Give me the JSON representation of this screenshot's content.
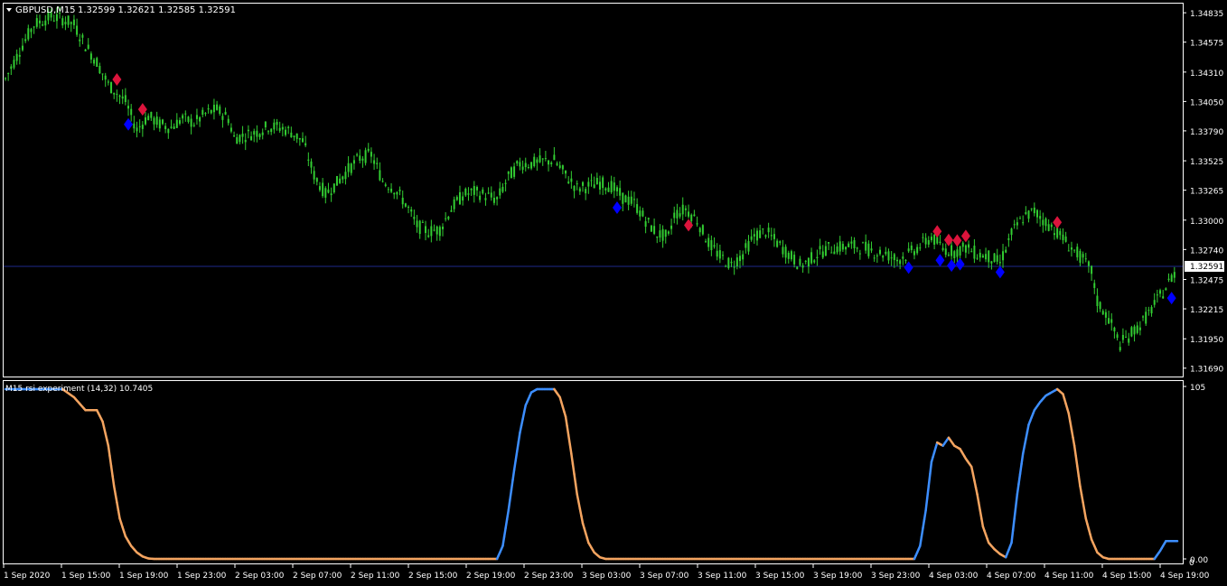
{
  "main_header": {
    "menu_icon": "triangle-down-icon",
    "symbol": "GBPUSD,M15",
    "ohlc": "1.32599 1.32621 1.32585 1.32591"
  },
  "sub_header": {
    "label": "M15 rsi experiment (14,32) 10.7405"
  },
  "price_axis": {
    "ticks": [
      "1.34835",
      "1.34575",
      "1.34310",
      "1.34050",
      "1.33790",
      "1.33525",
      "1.33265",
      "1.33000",
      "1.32740",
      "1.32475",
      "1.32215",
      "1.31950",
      "1.31690"
    ],
    "current_price": "1.32591"
  },
  "osc_axis": {
    "ticks": [
      "105",
      "0.00"
    ],
    "extra": "0"
  },
  "time_axis": {
    "labels": [
      "1 Sep 2020",
      "1 Sep 15:00",
      "1 Sep 19:00",
      "1 Sep 23:00",
      "2 Sep 03:00",
      "2 Sep 07:00",
      "2 Sep 11:00",
      "2 Sep 15:00",
      "2 Sep 19:00",
      "2 Sep 23:00",
      "3 Sep 03:00",
      "3 Sep 07:00",
      "3 Sep 11:00",
      "3 Sep 15:00",
      "3 Sep 19:00",
      "3 Sep 23:00",
      "4 Sep 03:00",
      "4 Sep 07:00",
      "4 Sep 11:00",
      "4 Sep 15:00",
      "4 Sep 19:00"
    ]
  },
  "colors": {
    "background": "#000000",
    "grid": "#ffffff",
    "candles": "#32cd32",
    "price_line": "#1e2a8c",
    "sell_marker": "#dc143c",
    "buy_marker": "#0000ff",
    "rsi_up": "#3d8eff",
    "rsi_down": "#f4a460"
  },
  "chart_data": [
    {
      "type": "candlestick",
      "title": "GBPUSD,M15",
      "ylim": [
        1.3164,
        1.349
      ],
      "price_line": 1.32591,
      "path": [
        [
          0,
          1.3425
        ],
        [
          3,
          1.3455
        ],
        [
          5,
          1.3473
        ],
        [
          8,
          1.348
        ],
        [
          10,
          1.3478
        ],
        [
          12,
          1.3473
        ],
        [
          14,
          1.3455
        ],
        [
          16,
          1.344
        ],
        [
          18,
          1.342
        ],
        [
          21,
          1.3405
        ],
        [
          23,
          1.338
        ],
        [
          25,
          1.3392
        ],
        [
          27,
          1.3385
        ],
        [
          29,
          1.3382
        ],
        [
          31,
          1.339
        ],
        [
          33,
          1.3386
        ],
        [
          35,
          1.3394
        ],
        [
          37,
          1.3398
        ],
        [
          39,
          1.339
        ],
        [
          40,
          1.3373
        ],
        [
          42,
          1.3375
        ],
        [
          44,
          1.3378
        ],
        [
          46,
          1.3383
        ],
        [
          48,
          1.3382
        ],
        [
          50,
          1.3378
        ],
        [
          52,
          1.337
        ],
        [
          54,
          1.334
        ],
        [
          56,
          1.3323
        ],
        [
          58,
          1.3333
        ],
        [
          60,
          1.3345
        ],
        [
          62,
          1.3355
        ],
        [
          64,
          1.3358
        ],
        [
          66,
          1.3335
        ],
        [
          68,
          1.3328
        ],
        [
          70,
          1.3315
        ],
        [
          72,
          1.3295
        ],
        [
          74,
          1.329
        ],
        [
          76,
          1.3292
        ],
        [
          78,
          1.331
        ],
        [
          80,
          1.3322
        ],
        [
          82,
          1.3325
        ],
        [
          84,
          1.3322
        ],
        [
          86,
          1.3318
        ],
        [
          88,
          1.3338
        ],
        [
          90,
          1.335
        ],
        [
          92,
          1.335
        ],
        [
          94,
          1.3352
        ],
        [
          96,
          1.3353
        ],
        [
          98,
          1.334
        ],
        [
          100,
          1.3328
        ],
        [
          102,
          1.333
        ],
        [
          104,
          1.3333
        ],
        [
          106,
          1.333
        ],
        [
          108,
          1.332
        ],
        [
          110,
          1.3315
        ],
        [
          112,
          1.33
        ],
        [
          114,
          1.3288
        ],
        [
          116,
          1.3285
        ],
        [
          117,
          1.3305
        ],
        [
          119,
          1.331
        ],
        [
          121,
          1.33
        ],
        [
          123,
          1.328
        ],
        [
          125,
          1.3268
        ],
        [
          127,
          1.326
        ],
        [
          129,
          1.327
        ],
        [
          131,
          1.3286
        ],
        [
          133,
          1.329
        ],
        [
          135,
          1.328
        ],
        [
          137,
          1.327
        ],
        [
          139,
          1.326
        ],
        [
          140,
          1.3262
        ],
        [
          142,
          1.327
        ],
        [
          144,
          1.3275
        ],
        [
          146,
          1.3276
        ],
        [
          148,
          1.3277
        ],
        [
          150,
          1.3276
        ],
        [
          152,
          1.3272
        ],
        [
          154,
          1.327
        ],
        [
          156,
          1.3265
        ],
        [
          158,
          1.327
        ],
        [
          160,
          1.3277
        ],
        [
          162,
          1.3285
        ],
        [
          164,
          1.3275
        ],
        [
          166,
          1.3272
        ],
        [
          168,
          1.3276
        ],
        [
          170,
          1.327
        ],
        [
          172,
          1.3268
        ],
        [
          174,
          1.3262
        ],
        [
          176,
          1.3288
        ],
        [
          178,
          1.3302
        ],
        [
          180,
          1.3308
        ],
        [
          182,
          1.3298
        ],
        [
          184,
          1.329
        ],
        [
          186,
          1.3278
        ],
        [
          188,
          1.3268
        ],
        [
          190,
          1.3255
        ],
        [
          191,
          1.3228
        ],
        [
          193,
          1.3213
        ],
        [
          195,
          1.319
        ],
        [
          197,
          1.32
        ],
        [
          199,
          1.321
        ],
        [
          201,
          1.3225
        ],
        [
          203,
          1.324
        ],
        [
          205,
          1.3258
        ]
      ]
    },
    {
      "type": "line",
      "title": "M15 rsi experiment (14,32) 10.7405",
      "ylim": [
        0,
        105
      ],
      "series": [
        {
          "path": [
            [
              0,
              105
            ],
            [
              10,
              105
            ],
            [
              12,
              100
            ],
            [
              14,
              92
            ],
            [
              16,
              92
            ],
            [
              17,
              85
            ],
            [
              18,
              70
            ],
            [
              19,
              45
            ],
            [
              20,
              25
            ],
            [
              21,
              14
            ],
            [
              22,
              8
            ],
            [
              23,
              4
            ],
            [
              24,
              1.5
            ],
            [
              25,
              0.3
            ],
            [
              26,
              0
            ],
            [
              86,
              0
            ],
            [
              87,
              8
            ],
            [
              88,
              30
            ],
            [
              89,
              55
            ],
            [
              90,
              78
            ],
            [
              91,
              95
            ],
            [
              92,
              103
            ],
            [
              93,
              105
            ],
            [
              96,
              105
            ],
            [
              97,
              100
            ],
            [
              98,
              88
            ],
            [
              99,
              65
            ],
            [
              100,
              40
            ],
            [
              101,
              22
            ],
            [
              102,
              10
            ],
            [
              103,
              4
            ],
            [
              104,
              1
            ],
            [
              105,
              0
            ],
            [
              159,
              0
            ],
            [
              160,
              8
            ],
            [
              161,
              30
            ],
            [
              162,
              60
            ],
            [
              163,
              72
            ],
            [
              164,
              70
            ],
            [
              165,
              75
            ],
            [
              166,
              70
            ],
            [
              167,
              68
            ],
            [
              168,
              62
            ],
            [
              169,
              57
            ],
            [
              170,
              40
            ],
            [
              171,
              20
            ],
            [
              172,
              10
            ],
            [
              173,
              6
            ],
            [
              174,
              3
            ],
            [
              175,
              1
            ],
            [
              176,
              10
            ],
            [
              177,
              40
            ],
            [
              178,
              65
            ],
            [
              179,
              83
            ],
            [
              180,
              92
            ],
            [
              181,
              97
            ],
            [
              182,
              101
            ],
            [
              183,
              103
            ],
            [
              184,
              105
            ],
            [
              185,
              102
            ],
            [
              186,
              90
            ],
            [
              187,
              70
            ],
            [
              188,
              45
            ],
            [
              189,
              25
            ],
            [
              190,
              12
            ],
            [
              191,
              4
            ],
            [
              192,
              1
            ],
            [
              193,
              0
            ],
            [
              201,
              0
            ],
            [
              202,
              5
            ],
            [
              203,
              11
            ]
          ]
        }
      ]
    }
  ]
}
